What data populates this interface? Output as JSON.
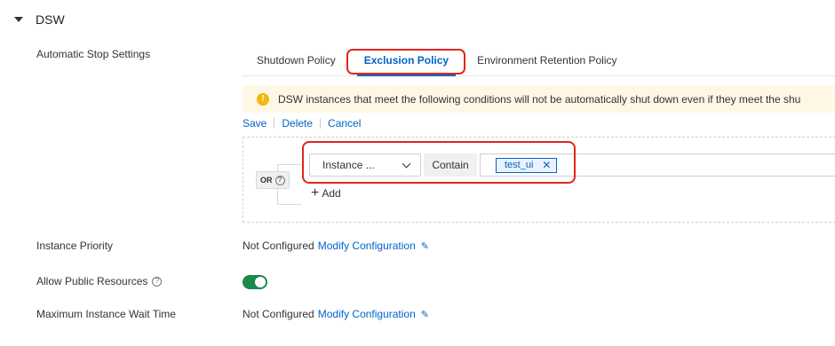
{
  "section": {
    "title": "DSW"
  },
  "labels": {
    "auto_stop": "Automatic Stop Settings",
    "priority": "Instance Priority",
    "public_resources": "Allow Public Resources",
    "wait_time": "Maximum Instance Wait Time"
  },
  "tabs": [
    {
      "label": "Shutdown Policy"
    },
    {
      "label": "Exclusion Policy",
      "active": true
    },
    {
      "label": "Environment Retention Policy"
    }
  ],
  "notice": {
    "text": "DSW instances that meet the following conditions will not be automatically shut down even if they meet the shu"
  },
  "actions": {
    "save": "Save",
    "delete": "Delete",
    "cancel": "Cancel"
  },
  "rule": {
    "logic": "OR",
    "field": "Instance ...",
    "operator": "Contain",
    "value_tag": "test_ui",
    "add_label": "Add"
  },
  "priority": {
    "status": "Not Configured",
    "link": "Modify Configuration"
  },
  "public_resources": {
    "enabled": true
  },
  "wait_time": {
    "status": "Not Configured",
    "link": "Modify Configuration"
  },
  "colors": {
    "accent": "#0064c8",
    "highlight": "#e0261c",
    "toggle_on": "#1e8a47",
    "warning": "#f5b60d"
  },
  "icons": [
    "caret-down-icon",
    "help-icon",
    "warning-icon",
    "chevron-down-icon",
    "close-icon",
    "plus-icon",
    "edit-icon"
  ]
}
